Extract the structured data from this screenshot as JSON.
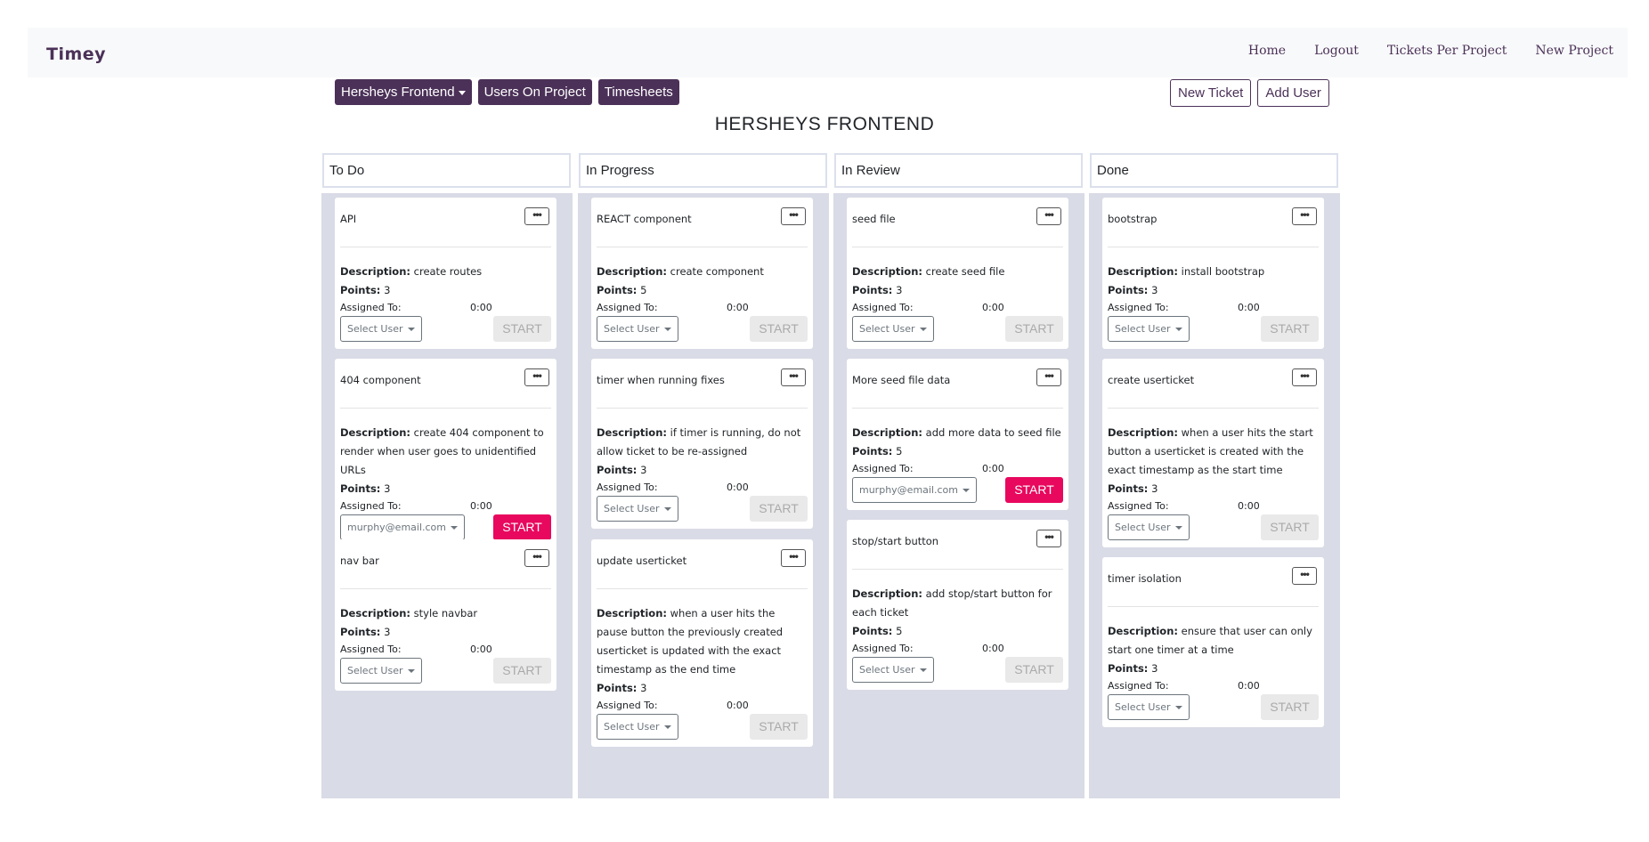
{
  "brand": "Timey",
  "nav": {
    "home": "Home",
    "logout": "Logout",
    "tickets_per_project": "Tickets Per Project",
    "new_project": "New Project"
  },
  "toolbar": {
    "project_dropdown": "Hersheys Frontend",
    "users_on_project": "Users On Project",
    "timesheets": "Timesheets",
    "new_ticket": "New Ticket",
    "add_user": "Add User"
  },
  "project_title": "HERSHEYS FRONTEND",
  "labels": {
    "description": "Description:",
    "points": "Points:",
    "assigned_to": "Assigned To:",
    "start": "START",
    "more": "•••"
  },
  "columns": [
    {
      "title": "To Do",
      "cards": [
        {
          "title": "API",
          "description": "create routes",
          "points": "3",
          "time": "0:00",
          "assigned": "Select User",
          "active": false
        },
        {
          "title": "404 component",
          "description": "create 404 component to render when user goes to unidentified URLs",
          "points": "3",
          "time": "0:00",
          "assigned": "murphy@email.com",
          "active": true
        },
        {
          "title": "nav bar",
          "description": "style navbar",
          "points": "3",
          "time": "0:00",
          "assigned": "Select User",
          "active": false
        }
      ]
    },
    {
      "title": "In Progress",
      "cards": [
        {
          "title": "REACT component",
          "description": "create component",
          "points": "5",
          "time": "0:00",
          "assigned": "Select User",
          "active": false
        },
        {
          "title": "timer when running fixes",
          "description": "if timer is running, do not allow ticket to be re-assigned",
          "points": "3",
          "time": "0:00",
          "assigned": "Select User",
          "active": false
        },
        {
          "title": "update userticket",
          "description": "when a user hits the pause button the previously created userticket is updated with the exact timestamp as the end time",
          "points": "3",
          "time": "0:00",
          "assigned": "Select User",
          "active": false
        }
      ]
    },
    {
      "title": "In Review",
      "cards": [
        {
          "title": "seed file",
          "description": "create seed file",
          "points": "3",
          "time": "0:00",
          "assigned": "Select User",
          "active": false
        },
        {
          "title": "More seed file data",
          "description": "add more data to seed file",
          "points": "5",
          "time": "0:00",
          "assigned": "murphy@email.com",
          "active": true
        },
        {
          "title": "stop/start button",
          "description": "add stop/start button for each ticket",
          "points": "5",
          "time": "0:00",
          "assigned": "Select User",
          "active": false
        }
      ]
    },
    {
      "title": "Done",
      "cards": [
        {
          "title": "bootstrap",
          "description": "install bootstrap",
          "points": "3",
          "time": "0:00",
          "assigned": "Select User",
          "active": false
        },
        {
          "title": "create userticket",
          "description": "when a user hits the start button a userticket is created with the exact timestamp as the start time",
          "points": "3",
          "time": "0:00",
          "assigned": "Select User",
          "active": false
        },
        {
          "title": "timer isolation",
          "description": "ensure that user can only start one timer at a time",
          "points": "3",
          "time": "0:00",
          "assigned": "Select User",
          "active": false
        }
      ]
    }
  ]
}
